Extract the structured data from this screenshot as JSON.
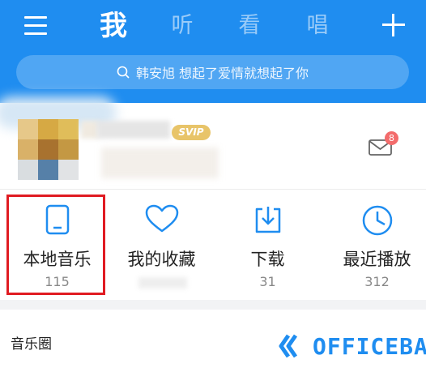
{
  "header": {
    "tabs": [
      {
        "label": "我",
        "active": true
      },
      {
        "label": "听",
        "active": false
      },
      {
        "label": "看",
        "active": false
      },
      {
        "label": "唱",
        "active": false
      }
    ],
    "search_placeholder": "韩安旭 想起了爱情就想起了你"
  },
  "profile": {
    "vip_badge": "SVIP",
    "mail_badge_count": "8"
  },
  "grid": [
    {
      "label": "本地音乐",
      "count": "115",
      "icon": "phone-icon"
    },
    {
      "label": "我的收藏",
      "count": "",
      "icon": "heart-icon"
    },
    {
      "label": "下载",
      "count": "31",
      "icon": "download-icon"
    },
    {
      "label": "最近播放",
      "count": "312",
      "icon": "clock-icon"
    }
  ],
  "section": {
    "music_circle": "音乐圈"
  },
  "watermark": {
    "text": "OFFICEBA"
  },
  "colors": {
    "brand": "#1f8df0",
    "highlight": "#e01b22",
    "badge": "#f36c6c",
    "vip": "#e8c469"
  }
}
